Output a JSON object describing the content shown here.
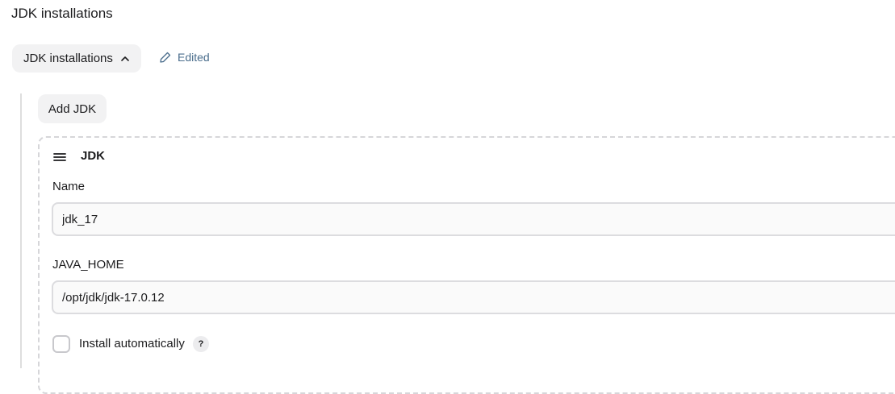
{
  "section": {
    "title": "JDK installations"
  },
  "toggle": {
    "label": "JDK installations",
    "icon": "chevron-up-icon"
  },
  "status": {
    "edited_label": "Edited",
    "icon": "pencil-icon",
    "color": "#4a6d8c"
  },
  "add_button": {
    "label": "Add JDK"
  },
  "jdk": {
    "header": "JDK",
    "name_label": "Name",
    "name_value": "jdk_17",
    "java_home_label": "JAVA_HOME",
    "java_home_value": "/opt/jdk/jdk-17.0.12",
    "install_auto_label": "Install automatically",
    "install_auto_checked": false,
    "help_label": "?"
  }
}
